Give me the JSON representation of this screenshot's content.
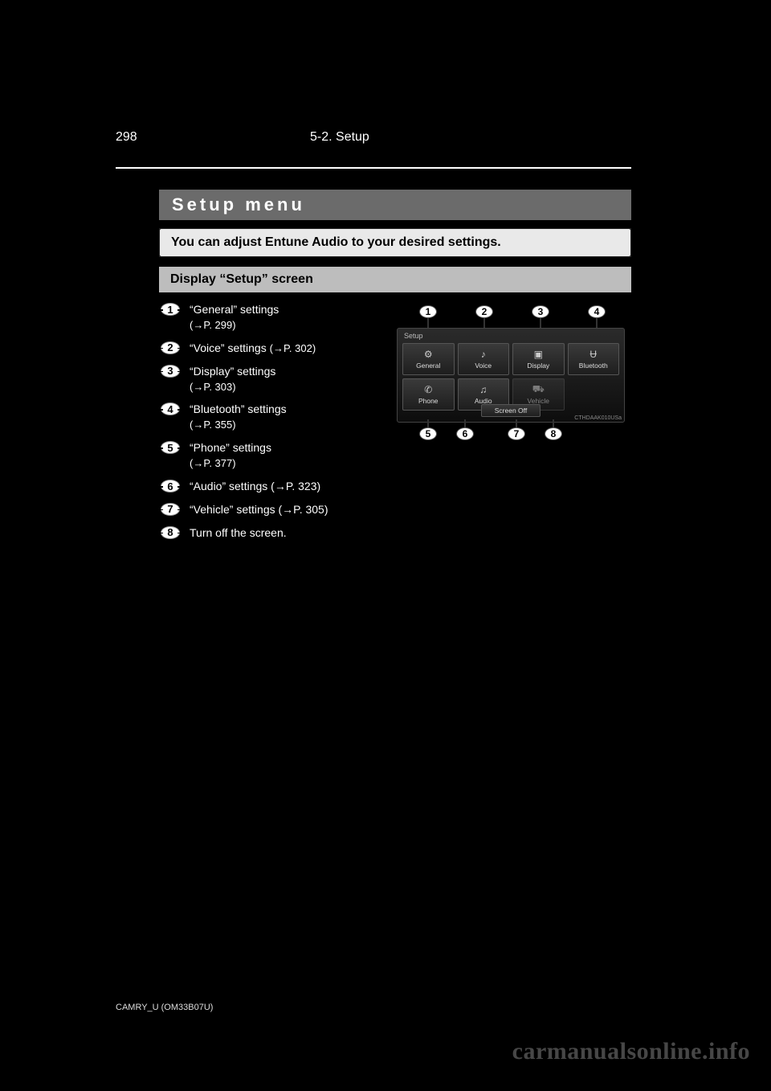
{
  "page_number": "298",
  "chapter": "5-2. Setup",
  "section_title": "Setup menu",
  "intro": "You can adjust Entune Audio to your desired settings.",
  "subsection": "Display “Setup” screen",
  "items": [
    {
      "n": "1",
      "text": "“General” settings",
      "ref": "(→P. 299)"
    },
    {
      "n": "2",
      "text": "“Voice” settings",
      "ref": "(→P. 302)"
    },
    {
      "n": "3",
      "text": "“Display” settings",
      "ref": "(→P. 303)"
    },
    {
      "n": "4",
      "text": "“Bluetooth” settings",
      "ref": "(→P. 355)"
    },
    {
      "n": "5",
      "text": "“Phone” settings",
      "ref": "(→P. 377)"
    },
    {
      "n": "6",
      "text": "“Audio” settings (→P. 323)",
      "ref": ""
    },
    {
      "n": "7",
      "text": "“Vehicle” settings (→P. 305)",
      "ref": ""
    },
    {
      "n": "8",
      "text": "Turn off the screen.",
      "ref": ""
    }
  ],
  "figure": {
    "header": "Setup",
    "top_callouts": [
      "1",
      "2",
      "3",
      "4"
    ],
    "bottom_callouts": [
      "5",
      "6",
      "7",
      "8"
    ],
    "tiles": [
      {
        "icon": "⚙",
        "label": "General",
        "name": "tile-general"
      },
      {
        "icon": "♪",
        "label": "Voice",
        "name": "tile-voice"
      },
      {
        "icon": "▣",
        "label": "Display",
        "name": "tile-display"
      },
      {
        "icon": "Ʉ",
        "label": "Bluetooth",
        "name": "tile-bluetooth"
      },
      {
        "icon": "✆",
        "label": "Phone",
        "name": "tile-phone"
      },
      {
        "icon": "♫",
        "label": "Audio",
        "name": "tile-audio"
      },
      {
        "icon": "⛟",
        "label": "Vehicle",
        "name": "tile-vehicle"
      }
    ],
    "screen_off": "Screen Off",
    "fig_id": "CTHDAAK010USa"
  },
  "footer_left": "CAMRY_U (OM33B07U)",
  "watermark": "carmanualsonline.info"
}
